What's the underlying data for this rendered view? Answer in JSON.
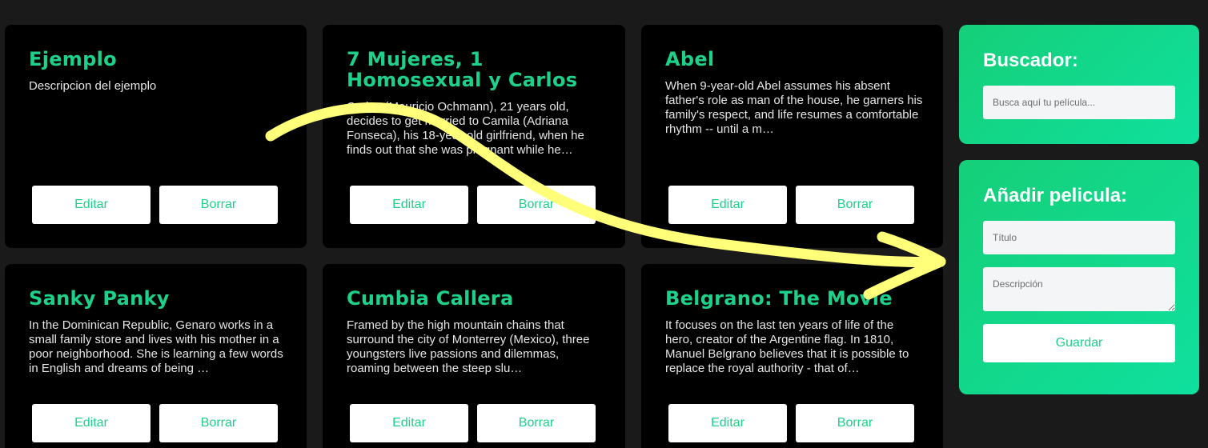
{
  "movies": [
    {
      "title": "Ejemplo",
      "description": "Descripcion del ejemplo",
      "edit_label": "Editar",
      "delete_label": "Borrar"
    },
    {
      "title": "7 Mujeres, 1 Homosexual y Carlos",
      "description": "Carlos (Mauricio Ochmann), 21 years old, decides to get married to Camila (Adriana Fonseca), his 18-year-old girlfriend, when he finds out that she was pregnant while he…",
      "edit_label": "Editar",
      "delete_label": "Borrar"
    },
    {
      "title": "Abel",
      "description": "When 9-year-old Abel assumes his absent father's role as man of the house, he garners his family's respect, and life resumes a comfortable rhythm -- until a m…",
      "edit_label": "Editar",
      "delete_label": "Borrar"
    },
    {
      "title": "Sanky Panky",
      "description": "In the Dominican Republic, Genaro works in a small family store and lives with his mother in a poor neighborhood. She is learning a few words in English and dreams of being …",
      "edit_label": "Editar",
      "delete_label": "Borrar"
    },
    {
      "title": "Cumbia Callera",
      "description": "Framed by the high mountain chains that surround the city of Monterrey (Mexico), three youngsters live passions and dilemmas, roaming between the steep slu…",
      "edit_label": "Editar",
      "delete_label": "Borrar"
    },
    {
      "title": "Belgrano: The Movie",
      "description": "It focuses on the last ten years of life of the hero, creator of the Argentine flag. In 1810, Manuel Belgrano believes that it is possible to replace the royal authority - that of…",
      "edit_label": "Editar",
      "delete_label": "Borrar"
    }
  ],
  "search": {
    "title": "Buscador:",
    "placeholder": "Busca aquí tu película..."
  },
  "add_movie": {
    "title": "Añadir pelicula:",
    "title_placeholder": "Título",
    "description_placeholder": "Descripción",
    "save_label": "Guardar"
  },
  "colors": {
    "accent": "#1ed18a",
    "background": "#1a1a1a",
    "card": "#000000",
    "annotation_arrow": "#ffff7a"
  },
  "annotation": {
    "icon": "curved-arrow-icon"
  }
}
